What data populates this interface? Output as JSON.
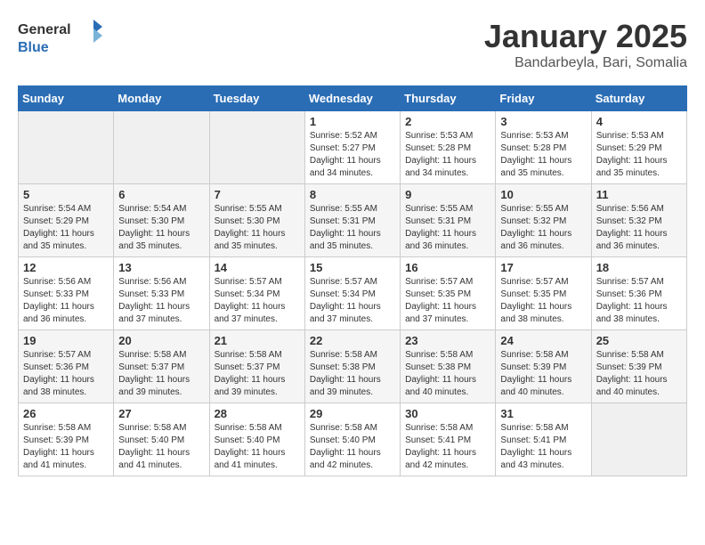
{
  "header": {
    "logo_line1": "General",
    "logo_line2": "Blue",
    "title": "January 2025",
    "subtitle": "Bandarbeyla, Bari, Somalia"
  },
  "weekdays": [
    "Sunday",
    "Monday",
    "Tuesday",
    "Wednesday",
    "Thursday",
    "Friday",
    "Saturday"
  ],
  "weeks": [
    [
      {
        "day": "",
        "empty": true
      },
      {
        "day": "",
        "empty": true
      },
      {
        "day": "",
        "empty": true
      },
      {
        "day": "1",
        "sunrise": "5:52 AM",
        "sunset": "5:27 PM",
        "daylight": "11 hours and 34 minutes."
      },
      {
        "day": "2",
        "sunrise": "5:53 AM",
        "sunset": "5:28 PM",
        "daylight": "11 hours and 34 minutes."
      },
      {
        "day": "3",
        "sunrise": "5:53 AM",
        "sunset": "5:28 PM",
        "daylight": "11 hours and 35 minutes."
      },
      {
        "day": "4",
        "sunrise": "5:53 AM",
        "sunset": "5:29 PM",
        "daylight": "11 hours and 35 minutes."
      }
    ],
    [
      {
        "day": "5",
        "sunrise": "5:54 AM",
        "sunset": "5:29 PM",
        "daylight": "11 hours and 35 minutes."
      },
      {
        "day": "6",
        "sunrise": "5:54 AM",
        "sunset": "5:30 PM",
        "daylight": "11 hours and 35 minutes."
      },
      {
        "day": "7",
        "sunrise": "5:55 AM",
        "sunset": "5:30 PM",
        "daylight": "11 hours and 35 minutes."
      },
      {
        "day": "8",
        "sunrise": "5:55 AM",
        "sunset": "5:31 PM",
        "daylight": "11 hours and 35 minutes."
      },
      {
        "day": "9",
        "sunrise": "5:55 AM",
        "sunset": "5:31 PM",
        "daylight": "11 hours and 36 minutes."
      },
      {
        "day": "10",
        "sunrise": "5:55 AM",
        "sunset": "5:32 PM",
        "daylight": "11 hours and 36 minutes."
      },
      {
        "day": "11",
        "sunrise": "5:56 AM",
        "sunset": "5:32 PM",
        "daylight": "11 hours and 36 minutes."
      }
    ],
    [
      {
        "day": "12",
        "sunrise": "5:56 AM",
        "sunset": "5:33 PM",
        "daylight": "11 hours and 36 minutes."
      },
      {
        "day": "13",
        "sunrise": "5:56 AM",
        "sunset": "5:33 PM",
        "daylight": "11 hours and 37 minutes."
      },
      {
        "day": "14",
        "sunrise": "5:57 AM",
        "sunset": "5:34 PM",
        "daylight": "11 hours and 37 minutes."
      },
      {
        "day": "15",
        "sunrise": "5:57 AM",
        "sunset": "5:34 PM",
        "daylight": "11 hours and 37 minutes."
      },
      {
        "day": "16",
        "sunrise": "5:57 AM",
        "sunset": "5:35 PM",
        "daylight": "11 hours and 37 minutes."
      },
      {
        "day": "17",
        "sunrise": "5:57 AM",
        "sunset": "5:35 PM",
        "daylight": "11 hours and 38 minutes."
      },
      {
        "day": "18",
        "sunrise": "5:57 AM",
        "sunset": "5:36 PM",
        "daylight": "11 hours and 38 minutes."
      }
    ],
    [
      {
        "day": "19",
        "sunrise": "5:57 AM",
        "sunset": "5:36 PM",
        "daylight": "11 hours and 38 minutes."
      },
      {
        "day": "20",
        "sunrise": "5:58 AM",
        "sunset": "5:37 PM",
        "daylight": "11 hours and 39 minutes."
      },
      {
        "day": "21",
        "sunrise": "5:58 AM",
        "sunset": "5:37 PM",
        "daylight": "11 hours and 39 minutes."
      },
      {
        "day": "22",
        "sunrise": "5:58 AM",
        "sunset": "5:38 PM",
        "daylight": "11 hours and 39 minutes."
      },
      {
        "day": "23",
        "sunrise": "5:58 AM",
        "sunset": "5:38 PM",
        "daylight": "11 hours and 40 minutes."
      },
      {
        "day": "24",
        "sunrise": "5:58 AM",
        "sunset": "5:39 PM",
        "daylight": "11 hours and 40 minutes."
      },
      {
        "day": "25",
        "sunrise": "5:58 AM",
        "sunset": "5:39 PM",
        "daylight": "11 hours and 40 minutes."
      }
    ],
    [
      {
        "day": "26",
        "sunrise": "5:58 AM",
        "sunset": "5:39 PM",
        "daylight": "11 hours and 41 minutes."
      },
      {
        "day": "27",
        "sunrise": "5:58 AM",
        "sunset": "5:40 PM",
        "daylight": "11 hours and 41 minutes."
      },
      {
        "day": "28",
        "sunrise": "5:58 AM",
        "sunset": "5:40 PM",
        "daylight": "11 hours and 41 minutes."
      },
      {
        "day": "29",
        "sunrise": "5:58 AM",
        "sunset": "5:40 PM",
        "daylight": "11 hours and 42 minutes."
      },
      {
        "day": "30",
        "sunrise": "5:58 AM",
        "sunset": "5:41 PM",
        "daylight": "11 hours and 42 minutes."
      },
      {
        "day": "31",
        "sunrise": "5:58 AM",
        "sunset": "5:41 PM",
        "daylight": "11 hours and 43 minutes."
      },
      {
        "day": "",
        "empty": true
      }
    ]
  ]
}
